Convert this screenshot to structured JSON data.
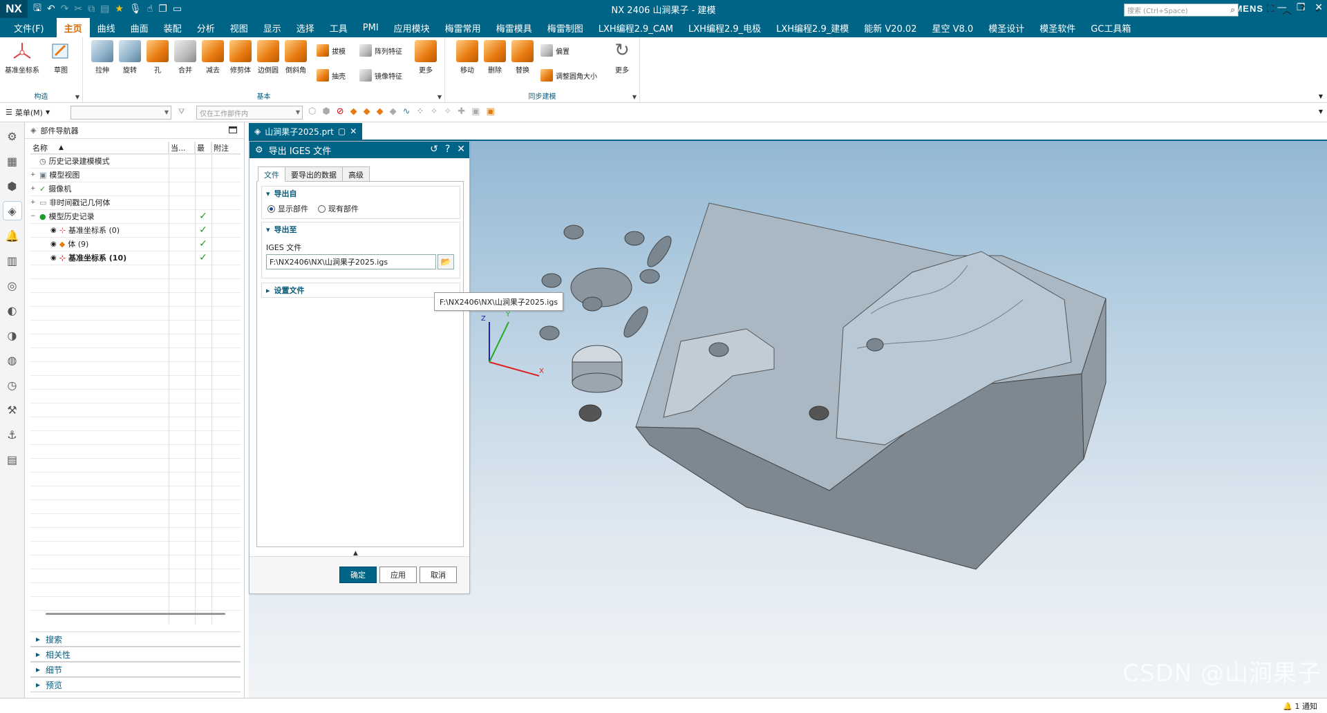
{
  "titlebar": {
    "logo": "NX",
    "title": "NX 2406 山涧果子 - 建模",
    "brand": "SIEMENS"
  },
  "menubar": {
    "items": [
      "文件(F)",
      "主页",
      "曲线",
      "曲面",
      "装配",
      "分析",
      "视图",
      "显示",
      "选择",
      "工具",
      "PMI",
      "应用模块",
      "梅雷常用",
      "梅雷模具",
      "梅雷制图",
      "LXH编程2.9_CAM",
      "LXH编程2.9_电极",
      "LXH编程2.9_建模",
      "能新 V20.02",
      "星空 V8.0",
      "模圣设计",
      "模圣软件",
      "GC工具箱"
    ],
    "active_index": 1,
    "search_placeholder": "搜索 (Ctrl+Space)"
  },
  "ribbon": {
    "groups": {
      "construct": "构造",
      "basic": "基本",
      "sync": "同步建模"
    },
    "buttons": {
      "datum_csys": "基准坐标系",
      "sketch": "草图",
      "extrude": "拉伸",
      "revolve": "旋转",
      "hole": "孔",
      "unite": "合并",
      "subtract": "减去",
      "trim_body": "修剪体",
      "edge_blend": "边倒圆",
      "chamfer": "倒斜角",
      "draft": "拔模",
      "shell": "抽壳",
      "pattern_feature": "阵列特征",
      "mirror_feature": "镜像特征",
      "more1": "更多",
      "move": "移动",
      "delete": "删除",
      "replace": "替换",
      "offset": "偏置",
      "resize_blend": "调整圆角大小",
      "more2": "更多"
    }
  },
  "toolrow": {
    "menu_label": "菜单(M)",
    "filter_placeholder": "",
    "scope_placeholder": "仅在工作部件内"
  },
  "navigator": {
    "title": "部件导航器",
    "columns": [
      "名称",
      "当...",
      "最",
      "附注"
    ],
    "rows": [
      {
        "label": "历史记录建模模式",
        "check": "",
        "bold": false
      },
      {
        "label": "模型视图",
        "check": "",
        "bold": false
      },
      {
        "label": "摄像机",
        "check": "",
        "bold": false
      },
      {
        "label": "非时间戳记几何体",
        "check": "",
        "bold": false
      },
      {
        "label": "模型历史记录",
        "check": "✓",
        "bold": false
      },
      {
        "label": "基准坐标系 (0)",
        "check": "✓",
        "bold": false
      },
      {
        "label": "体 (9)",
        "check": "✓",
        "bold": false
      },
      {
        "label": "基准坐标系 (10)",
        "check": "✓",
        "bold": true
      }
    ],
    "sections": [
      "搜索",
      "相关性",
      "细节",
      "预览"
    ]
  },
  "doc_tab": {
    "label": "山涧果子2025.prt"
  },
  "dialog": {
    "title": "导出 IGES 文件",
    "tabs": [
      "文件",
      "要导出的数据",
      "高级"
    ],
    "export_from": {
      "heading": "导出自",
      "options": [
        "显示部件",
        "现有部件"
      ],
      "selected": 0
    },
    "export_to": {
      "heading": "导出至",
      "file_label": "IGES 文件",
      "path": "F:\\NX2406\\NX\\山涧果子2025.igs"
    },
    "settings_heading": "设置文件",
    "tooltip": "F:\\NX2406\\NX\\山涧果子2025.igs",
    "buttons": {
      "ok": "确定",
      "apply": "应用",
      "cancel": "取消"
    }
  },
  "triad": {
    "x": "X",
    "y": "Y",
    "z": "Z"
  },
  "watermark": "CSDN @山涧果子",
  "status": {
    "notification": "1 通知"
  },
  "colors": {
    "accent": "#006487",
    "active_menu": "#d86a00",
    "check": "#1a9c2a",
    "part_face": "#a9b7c2"
  }
}
